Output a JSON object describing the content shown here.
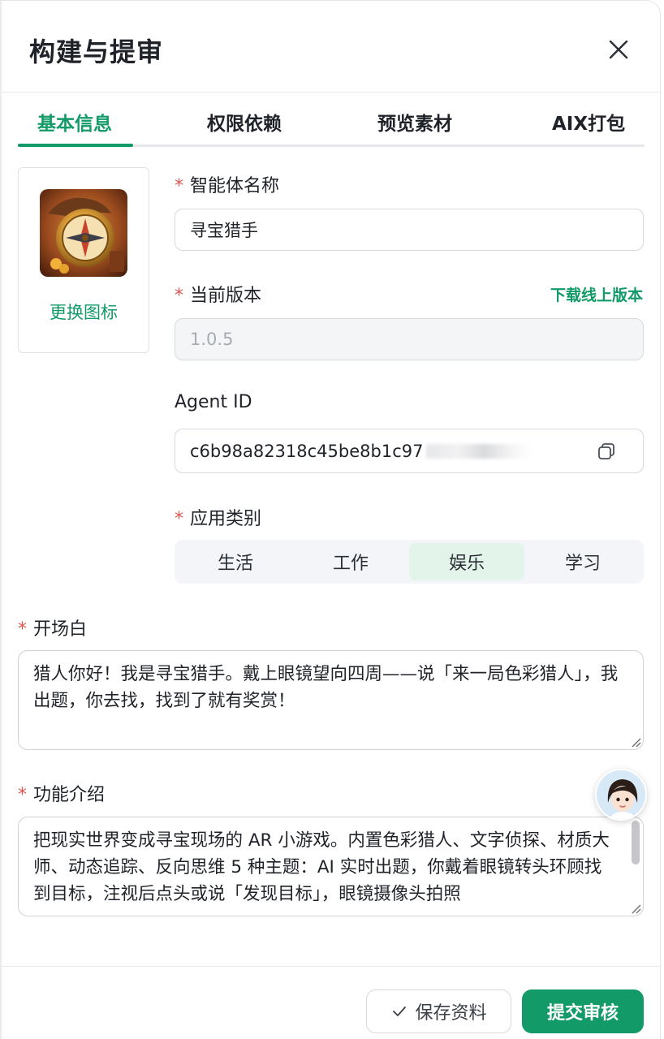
{
  "dialog": {
    "title": "构建与提审"
  },
  "tabs": [
    {
      "label": "基本信息",
      "active": true
    },
    {
      "label": "权限依赖",
      "active": false
    },
    {
      "label": "预览素材",
      "active": false
    },
    {
      "label": "AIX打包",
      "active": false
    }
  ],
  "icon_panel": {
    "change_label": "更换图标"
  },
  "fields": {
    "required_mark": "*",
    "agent_name": {
      "label": "智能体名称",
      "value": "寻宝猎手"
    },
    "version": {
      "label": "当前版本",
      "value": "1.0.5",
      "download_link": "下载线上版本"
    },
    "agent_id": {
      "label": "Agent ID",
      "value": "c6b98a82318c45be8b1c97"
    },
    "category": {
      "label": "应用类别",
      "options": [
        "生活",
        "工作",
        "娱乐",
        "学习"
      ],
      "selected": "娱乐"
    },
    "opening": {
      "label": "开场白",
      "value": "猎人你好！我是寻宝猎手。戴上眼镜望向四周——说「来一局色彩猎人」，我出题，你去找，找到了就有奖赏！"
    },
    "intro": {
      "label": "功能介绍",
      "value": "把现实世界变成寻宝现场的 AR 小游戏。内置色彩猎人、文字侦探、材质大师、动态追踪、反向思维 5 种主题：AI 实时出题，你戴着眼镜转头环顾找到目标，注视后点头或说「发现目标」，眼镜摄像头拍照"
    }
  },
  "footer": {
    "save_label": "保存资料",
    "submit_label": "提交审核"
  },
  "colors": {
    "accent": "#129a68",
    "required": "#e0554f",
    "selected_bg": "#e3f4ea"
  }
}
